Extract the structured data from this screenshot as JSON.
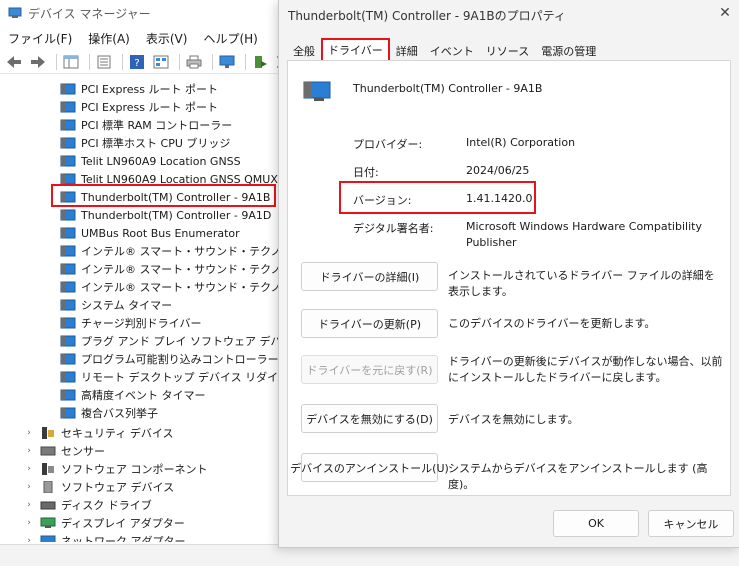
{
  "device_manager": {
    "title": "デバイス マネージャー",
    "menu": [
      "ファイル(F)",
      "操作(A)",
      "表示(V)",
      "ヘルプ(H)"
    ],
    "tree_items": [
      {
        "label": "PCI Express ルート ポート",
        "type": "child"
      },
      {
        "label": "PCI Express ルート ポート",
        "type": "child"
      },
      {
        "label": "PCI 標準 RAM コントローラー",
        "type": "child"
      },
      {
        "label": "PCI 標準ホスト CPU ブリッジ",
        "type": "child"
      },
      {
        "label": "Telit LN960A9 Location GNSS",
        "type": "child"
      },
      {
        "label": "Telit LN960A9 Location GNSS QMUX",
        "type": "child"
      },
      {
        "label": "Thunderbolt(TM) Controller - 9A1B",
        "type": "child",
        "selected": true
      },
      {
        "label": "Thunderbolt(TM) Controller - 9A1D",
        "type": "child"
      },
      {
        "label": "UMBus Root Bus Enumerator",
        "type": "child"
      },
      {
        "label": "インテル® スマート・サウンド・テクノロジー BU",
        "type": "child"
      },
      {
        "label": "インテル® スマート・サウンド・テクノロジー OE",
        "type": "child"
      },
      {
        "label": "インテル® スマート・サウンド・テクノロジー検出",
        "type": "child"
      },
      {
        "label": "システム タイマー",
        "type": "child"
      },
      {
        "label": "チャージ判別ドライバー",
        "type": "child"
      },
      {
        "label": "プラグ アンド プレイ ソフトウェア デバイス列挙",
        "type": "child"
      },
      {
        "label": "プログラム可能割り込みコントローラー",
        "type": "child"
      },
      {
        "label": "リモート デスクトップ デバイス リダイレクター バ",
        "type": "child"
      },
      {
        "label": "高精度イベント タイマー",
        "type": "child"
      },
      {
        "label": "複合バス列挙子",
        "type": "child"
      },
      {
        "label": "セキュリティ デバイス",
        "type": "category"
      },
      {
        "label": "センサー",
        "type": "category"
      },
      {
        "label": "ソフトウェア コンポーネント",
        "type": "category"
      },
      {
        "label": "ソフトウェア デバイス",
        "type": "category"
      },
      {
        "label": "ディスク ドライブ",
        "type": "category"
      },
      {
        "label": "ディスプレイ アダプター",
        "type": "category"
      },
      {
        "label": "ネットワーク アダプター",
        "type": "category"
      }
    ]
  },
  "dialog": {
    "title": "Thunderbolt(TM) Controller - 9A1Bのプロパティ",
    "tabs": [
      "全般",
      "ドライバー",
      "詳細",
      "イベント",
      "リソース",
      "電源の管理"
    ],
    "active_tab": "ドライバー",
    "device_name": "Thunderbolt(TM) Controller - 9A1B",
    "fields": {
      "provider_label": "プロバイダー:",
      "provider_value": "Intel(R) Corporation",
      "date_label": "日付:",
      "date_value": "2024/06/25",
      "version_label": "バージョン:",
      "version_value": "1.41.1420.0",
      "signer_label": "デジタル署名者:",
      "signer_value": "Microsoft Windows Hardware Compatibility Publisher"
    },
    "actions": [
      {
        "button": "ドライバーの詳細(I)",
        "description": "インストールされているドライバー ファイルの詳細を表示します。",
        "enabled": true
      },
      {
        "button": "ドライバーの更新(P)",
        "description": "このデバイスのドライバーを更新します。",
        "enabled": true
      },
      {
        "button": "ドライバーを元に戻す(R)",
        "description": "ドライバーの更新後にデバイスが動作しない場合、以前にインストールしたドライバーに戻します。",
        "enabled": false
      },
      {
        "button": "デバイスを無効にする(D)",
        "description": "デバイスを無効にします。",
        "enabled": true
      },
      {
        "button": "デバイスのアンインストール(U)",
        "description": "システムからデバイスをアンインストールします (高度)。",
        "enabled": true
      }
    ],
    "ok_label": "OK",
    "cancel_label": "キャンセル",
    "close_glyph": "✕"
  },
  "colors": {
    "highlight_red": "#e8131a",
    "device_icon_blue": "#2a7fd4",
    "dialog_bg": "#f3f3f3"
  }
}
